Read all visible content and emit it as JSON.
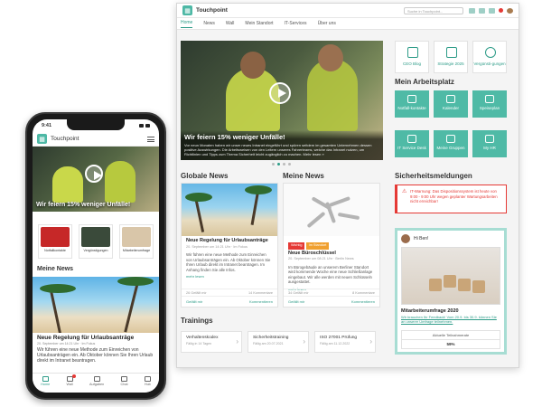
{
  "desktop": {
    "app_title": "Touchpoint",
    "search_placeholder": "Suche in Touchpoint...",
    "nav": [
      {
        "label": "Home",
        "active": true
      },
      {
        "label": "News"
      },
      {
        "label": "Wall"
      },
      {
        "label": "Mein Standort"
      },
      {
        "label": "IT-Services"
      },
      {
        "label": "Über uns"
      }
    ],
    "hero": {
      "title": "Wir feiern 15% weniger Unfälle!",
      "text": "Vor neun Monaten haben wir unser neues Intranet eingeführt und spüren seitdem im gesamten Unternehmen dessen positive Auswirkungen. Die Arbeitsweisen von den Leitern unseres Fahrerteams, welche das Intranet nutzen, um Richtlinien und Tipps zum Thema Sicherheit leicht zugänglich zu machen. Mehr lesen »"
    },
    "quick_links": [
      "CEO Blog",
      "Strategie 2025",
      "Vergünsti-gungen"
    ],
    "workplace": {
      "title": "Mein Arbeitsplatz",
      "tiles": [
        "Notfall-kontakte",
        "Kalender",
        "Speiseplan",
        "IT Service Desk",
        "Meine Gruppen",
        "My HR"
      ]
    },
    "global_news": {
      "title": "Globale News",
      "card": {
        "headline": "Neue Regelung für Urlaubsanträge",
        "meta": "20. September um 14:21 Uhr · Im Fokus",
        "text": "Wir führen eine neue Methode zum Einreichen von Urlaubsanträgen ein. Ab Oktober können Sie Ihren Urlaub direkt im Intranet beantragen. Im Anhang finden Sie alle Infos.",
        "more": "mehr lesen",
        "likes": "26 Gefällt mir",
        "comments": "14 Kommentare",
        "like_btn": "Gefällt mir",
        "comment_btn": "Kommentieren"
      }
    },
    "my_news": {
      "title": "Meine News",
      "card": {
        "tags": [
          "Wichtig",
          "Im Standort"
        ],
        "headline": "Neue Büroschlüssel",
        "meta": "20. September um 08:21 Uhr · Berlin News",
        "text": "Im Bürogebäude an unserem Berliner Standort wird kommende Woche eine neue Schließanlage eingebaut. Wir alle werden mit neuen Schlüsseln ausgestattet.",
        "more": "mehr lesen",
        "likes": "34 Gefällt mir",
        "comments": "8 Kommentare",
        "like_btn": "Gefällt mir",
        "comment_btn": "Kommentieren"
      }
    },
    "safety": {
      "title": "Sicherheitsmeldungen",
      "alert": "IT-Warnung: Das Dispositionssystem ist heute von 9:00 - 9:00 Uhr wegen geplanter Wartungsarbeiten nicht erreichbar!"
    },
    "greeting": {
      "hi": "Hi Ben!",
      "survey_title": "Mitarbeiterumfrage 2020",
      "survey_text": "Wir brauchen Ihr Feedback! Vom 20.9. bis 30.9. können Sie an unserer Umfrage teilnehmen.",
      "rate_label": "Aktuelle Teilnahmerate",
      "rate_value": "59%"
    },
    "trainings": {
      "title": "Trainings",
      "items": [
        {
          "name": "Verhaltenskodex",
          "due": "Fällig in 14 Tagen"
        },
        {
          "name": "Sicherheitstraining",
          "due": "Fällig am 20.07.2021"
        },
        {
          "name": "ISO 27001 Prüfung",
          "due": "Fällig am 11.12.2022"
        }
      ]
    }
  },
  "phone": {
    "time": "9:41",
    "app_title": "Touchpoint",
    "hero_title": "Wir feiern 15% weniger Unfälle!",
    "quick": [
      "Notfallkontakte",
      "Vergünstigungen",
      "Mitarbeiterumfrage"
    ],
    "news_title": "Meine News",
    "article_title": "Neue Regelung für Urlaubsanträge",
    "article_meta": "20. September um 14:21 Uhr · Im Fokus",
    "article_text": "Wir führen eine neue Methode zum Einreichen von Urlaubsanträgen ein. Ab Oktober können Sie Ihren Urlaub direkt im Intranet beantragen.",
    "tabs": [
      "Home",
      "Wall",
      "Aufgaben",
      "Chat",
      "Hub"
    ]
  },
  "colors": {
    "accent": "#4fbaa6",
    "alert": "#e53935"
  }
}
